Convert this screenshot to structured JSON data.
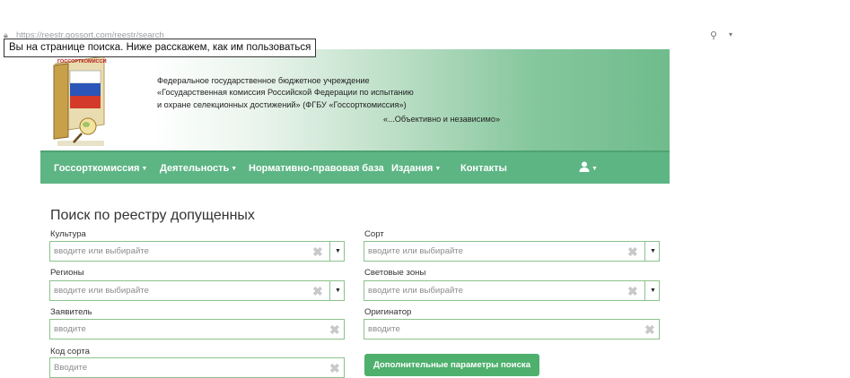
{
  "browser": {
    "url": "https://reestr.gossort.com/reestr/search"
  },
  "tooltip": "Вы на странице поиска. Ниже расскажем, как им пользоваться",
  "header": {
    "logo_text": "ГОССОРТКОМИССИЯ",
    "lines": [
      "Федеральное государственное бюджетное учреждение",
      "«Государственная комиссия Российской Федерации по испытанию",
      "и охране селекционных достижений» (ФГБУ «Госсорткомиссия»)"
    ],
    "motto": "«...Объективно и независимо»"
  },
  "nav": {
    "items": [
      {
        "label": "Госсорткомиссия",
        "dropdown": true
      },
      {
        "label": "Деятельность",
        "dropdown": true
      },
      {
        "label": "Нормативно-правовая база",
        "dropdown": false
      },
      {
        "label": "Издания",
        "dropdown": true
      },
      {
        "label": "Контакты",
        "dropdown": false
      }
    ],
    "user_icon": "user-icon"
  },
  "search": {
    "title": "Поиск по реестру допущенных",
    "fields": {
      "culture": {
        "label": "Культура",
        "placeholder": "вводите или выбирайте"
      },
      "variety": {
        "label": "Сорт",
        "placeholder": "вводите или выбирайте"
      },
      "regions": {
        "label": "Регионы",
        "placeholder": "вводите или выбирайте"
      },
      "light_zones": {
        "label": "Световые зоны",
        "placeholder": "вводите или выбирайте"
      },
      "applicant": {
        "label": "Заявитель",
        "placeholder": "вводите"
      },
      "originator": {
        "label": "Оригинатор",
        "placeholder": "вводите"
      },
      "variety_code": {
        "label": "Код сорта",
        "placeholder": "Вводите"
      }
    },
    "more_button": "Дополнительные параметры поиска"
  },
  "colors": {
    "nav_green": "#5db584",
    "field_border": "#8cc28c",
    "button_green": "#4fb06e"
  }
}
